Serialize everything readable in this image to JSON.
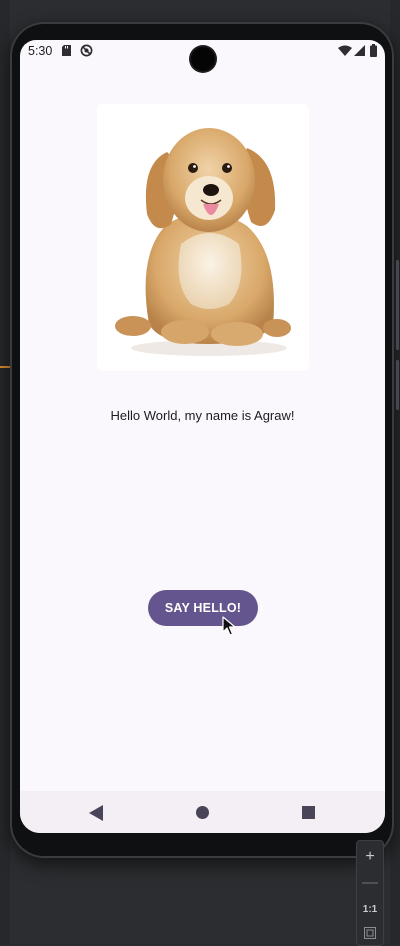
{
  "status_bar": {
    "time": "5:30",
    "icons": [
      "sd-card-icon",
      "sync-disabled-icon",
      "wifi-icon",
      "signal-icon",
      "battery-icon"
    ]
  },
  "content": {
    "image_alt": "dog",
    "greeting": "Hello World, my name is Agraw!",
    "button_label": "SAY HELLO!"
  },
  "nav_bar": {
    "icons": [
      "back-icon",
      "home-icon",
      "recents-icon"
    ]
  },
  "emulator_controls": {
    "zoom_in": "+",
    "zoom_out": "—",
    "zoom_reset": "1:1"
  },
  "colors": {
    "button": "#65558f",
    "screen_bg": "#fbf8fd",
    "accent": "#d7892e"
  }
}
